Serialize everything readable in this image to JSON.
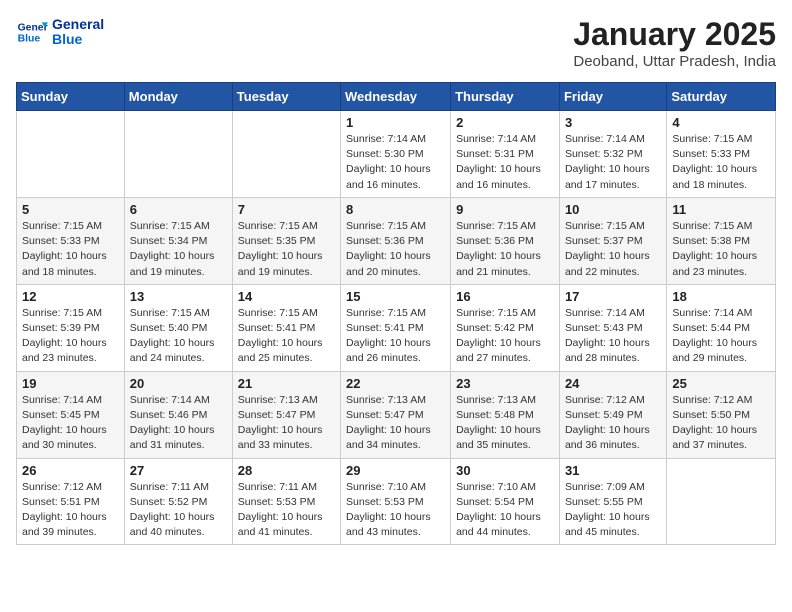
{
  "header": {
    "logo_line1": "General",
    "logo_line2": "Blue",
    "month": "January 2025",
    "location": "Deoband, Uttar Pradesh, India"
  },
  "days_of_week": [
    "Sunday",
    "Monday",
    "Tuesday",
    "Wednesday",
    "Thursday",
    "Friday",
    "Saturday"
  ],
  "weeks": [
    [
      {
        "day": "",
        "info": ""
      },
      {
        "day": "",
        "info": ""
      },
      {
        "day": "",
        "info": ""
      },
      {
        "day": "1",
        "info": "Sunrise: 7:14 AM\nSunset: 5:30 PM\nDaylight: 10 hours\nand 16 minutes."
      },
      {
        "day": "2",
        "info": "Sunrise: 7:14 AM\nSunset: 5:31 PM\nDaylight: 10 hours\nand 16 minutes."
      },
      {
        "day": "3",
        "info": "Sunrise: 7:14 AM\nSunset: 5:32 PM\nDaylight: 10 hours\nand 17 minutes."
      },
      {
        "day": "4",
        "info": "Sunrise: 7:15 AM\nSunset: 5:33 PM\nDaylight: 10 hours\nand 18 minutes."
      }
    ],
    [
      {
        "day": "5",
        "info": "Sunrise: 7:15 AM\nSunset: 5:33 PM\nDaylight: 10 hours\nand 18 minutes."
      },
      {
        "day": "6",
        "info": "Sunrise: 7:15 AM\nSunset: 5:34 PM\nDaylight: 10 hours\nand 19 minutes."
      },
      {
        "day": "7",
        "info": "Sunrise: 7:15 AM\nSunset: 5:35 PM\nDaylight: 10 hours\nand 19 minutes."
      },
      {
        "day": "8",
        "info": "Sunrise: 7:15 AM\nSunset: 5:36 PM\nDaylight: 10 hours\nand 20 minutes."
      },
      {
        "day": "9",
        "info": "Sunrise: 7:15 AM\nSunset: 5:36 PM\nDaylight: 10 hours\nand 21 minutes."
      },
      {
        "day": "10",
        "info": "Sunrise: 7:15 AM\nSunset: 5:37 PM\nDaylight: 10 hours\nand 22 minutes."
      },
      {
        "day": "11",
        "info": "Sunrise: 7:15 AM\nSunset: 5:38 PM\nDaylight: 10 hours\nand 23 minutes."
      }
    ],
    [
      {
        "day": "12",
        "info": "Sunrise: 7:15 AM\nSunset: 5:39 PM\nDaylight: 10 hours\nand 23 minutes."
      },
      {
        "day": "13",
        "info": "Sunrise: 7:15 AM\nSunset: 5:40 PM\nDaylight: 10 hours\nand 24 minutes."
      },
      {
        "day": "14",
        "info": "Sunrise: 7:15 AM\nSunset: 5:41 PM\nDaylight: 10 hours\nand 25 minutes."
      },
      {
        "day": "15",
        "info": "Sunrise: 7:15 AM\nSunset: 5:41 PM\nDaylight: 10 hours\nand 26 minutes."
      },
      {
        "day": "16",
        "info": "Sunrise: 7:15 AM\nSunset: 5:42 PM\nDaylight: 10 hours\nand 27 minutes."
      },
      {
        "day": "17",
        "info": "Sunrise: 7:14 AM\nSunset: 5:43 PM\nDaylight: 10 hours\nand 28 minutes."
      },
      {
        "day": "18",
        "info": "Sunrise: 7:14 AM\nSunset: 5:44 PM\nDaylight: 10 hours\nand 29 minutes."
      }
    ],
    [
      {
        "day": "19",
        "info": "Sunrise: 7:14 AM\nSunset: 5:45 PM\nDaylight: 10 hours\nand 30 minutes."
      },
      {
        "day": "20",
        "info": "Sunrise: 7:14 AM\nSunset: 5:46 PM\nDaylight: 10 hours\nand 31 minutes."
      },
      {
        "day": "21",
        "info": "Sunrise: 7:13 AM\nSunset: 5:47 PM\nDaylight: 10 hours\nand 33 minutes."
      },
      {
        "day": "22",
        "info": "Sunrise: 7:13 AM\nSunset: 5:47 PM\nDaylight: 10 hours\nand 34 minutes."
      },
      {
        "day": "23",
        "info": "Sunrise: 7:13 AM\nSunset: 5:48 PM\nDaylight: 10 hours\nand 35 minutes."
      },
      {
        "day": "24",
        "info": "Sunrise: 7:12 AM\nSunset: 5:49 PM\nDaylight: 10 hours\nand 36 minutes."
      },
      {
        "day": "25",
        "info": "Sunrise: 7:12 AM\nSunset: 5:50 PM\nDaylight: 10 hours\nand 37 minutes."
      }
    ],
    [
      {
        "day": "26",
        "info": "Sunrise: 7:12 AM\nSunset: 5:51 PM\nDaylight: 10 hours\nand 39 minutes."
      },
      {
        "day": "27",
        "info": "Sunrise: 7:11 AM\nSunset: 5:52 PM\nDaylight: 10 hours\nand 40 minutes."
      },
      {
        "day": "28",
        "info": "Sunrise: 7:11 AM\nSunset: 5:53 PM\nDaylight: 10 hours\nand 41 minutes."
      },
      {
        "day": "29",
        "info": "Sunrise: 7:10 AM\nSunset: 5:53 PM\nDaylight: 10 hours\nand 43 minutes."
      },
      {
        "day": "30",
        "info": "Sunrise: 7:10 AM\nSunset: 5:54 PM\nDaylight: 10 hours\nand 44 minutes."
      },
      {
        "day": "31",
        "info": "Sunrise: 7:09 AM\nSunset: 5:55 PM\nDaylight: 10 hours\nand 45 minutes."
      },
      {
        "day": "",
        "info": ""
      }
    ]
  ]
}
